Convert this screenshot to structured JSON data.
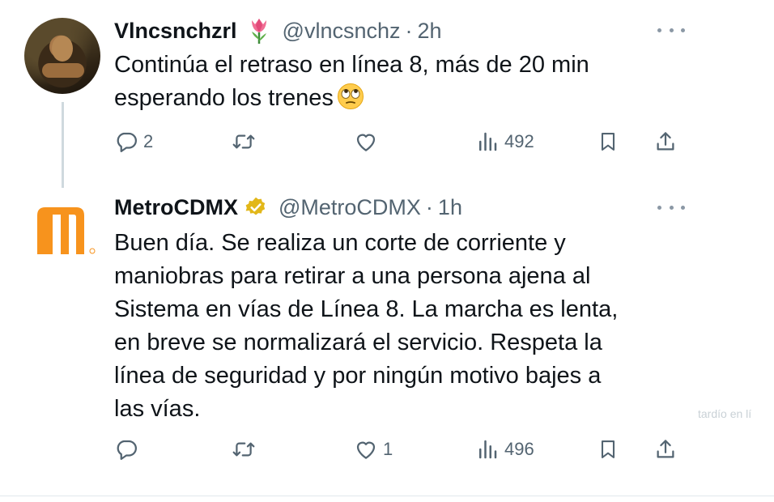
{
  "tweets": [
    {
      "display_name": "Vlncsnchzrl",
      "name_emoji": "tulip-emoji",
      "handle": "@vlncsnchz",
      "separator": "·",
      "time": "2h",
      "text_line1": "Continúa el retraso en línea 8, más de 20 min",
      "text_line2": "esperando los trenes",
      "text_emoji": "face-with-rolling-eyes-emoji",
      "replies": "2",
      "retweets": "",
      "likes": "",
      "views": "492"
    },
    {
      "display_name": "MetroCDMX",
      "badge": "gold-verified-badge",
      "handle": "@MetroCDMX",
      "separator": "·",
      "time": "1h",
      "text": "Buen día. Se realiza un corte de corriente y\nmaniobras para retirar a una persona ajena al\nSistema en vías de Línea 8. La marcha es lenta,\nen breve se normalizará el servicio. Respeta la\nlínea de seguridad y por ningún motivo bajes a\nlas vías.",
      "replies": "",
      "retweets": "",
      "likes": "1",
      "views": "496"
    }
  ],
  "colors": {
    "metro_orange": "#f7931d",
    "muted": "#536471",
    "text": "#0f1419",
    "thread_line": "#cfd9de",
    "verified_gold": "#e2b719"
  },
  "icons": [
    "reply-icon",
    "retweet-icon",
    "like-icon",
    "views-icon",
    "bookmark-icon",
    "share-icon",
    "more-icon"
  ],
  "background_fragment": "tardío en lí"
}
